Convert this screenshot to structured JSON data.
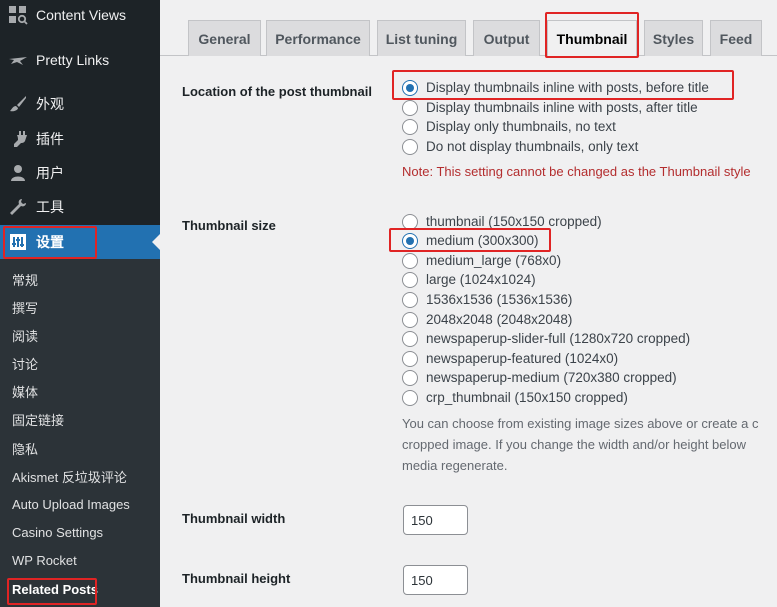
{
  "sidebar": {
    "menu": [
      {
        "label": "Content Views",
        "icon": "grid-icon"
      },
      {
        "label": "Pretty Links",
        "icon": "star-icon"
      },
      {
        "label": "外观",
        "icon": "paintbrush-icon"
      },
      {
        "label": "插件",
        "icon": "plugin-icon"
      },
      {
        "label": "用户",
        "icon": "user-icon"
      },
      {
        "label": "工具",
        "icon": "wrench-icon"
      },
      {
        "label": "设置",
        "icon": "settings-icon"
      }
    ],
    "submenu": [
      "常规",
      "撰写",
      "阅读",
      "讨论",
      "媒体",
      "固定链接",
      "隐私",
      "Akismet 反垃圾评论",
      "Auto Upload Images",
      "Casino Settings",
      "WP Rocket",
      "Related Posts"
    ]
  },
  "tabs": [
    "General",
    "Performance",
    "List tuning",
    "Output",
    "Thumbnail",
    "Styles",
    "Feed"
  ],
  "active_tab": "Thumbnail",
  "location": {
    "label": "Location of the post thumbnail",
    "options": [
      "Display thumbnails inline with posts, before title",
      "Display thumbnails inline with posts, after title",
      "Display only thumbnails, no text",
      "Do not display thumbnails, only text"
    ],
    "selected_index": 0,
    "note": "Note: This setting cannot be changed as the Thumbnail style"
  },
  "size": {
    "label": "Thumbnail size",
    "options": [
      "thumbnail (150x150 cropped)",
      "medium (300x300)",
      "medium_large (768x0)",
      "large (1024x1024)",
      "1536x1536 (1536x1536)",
      "2048x2048 (2048x2048)",
      "newspaperup-slider-full (1280x720 cropped)",
      "newspaperup-featured (1024x0)",
      "newspaperup-medium (720x380 cropped)",
      "crp_thumbnail (150x150 cropped)"
    ],
    "selected_index": 1,
    "description": [
      "You can choose from existing image sizes above or create a c",
      "cropped image. If you change the width and/or height below",
      "media regenerate."
    ]
  },
  "width": {
    "label": "Thumbnail width",
    "value": "150"
  },
  "height": {
    "label": "Thumbnail height",
    "value": "150"
  },
  "colors": {
    "sidebar_bg": "#1d2327",
    "submenu_bg": "#2c3338",
    "accent": "#2271b1",
    "highlight": "#e02424",
    "note": "#b32d2e"
  }
}
